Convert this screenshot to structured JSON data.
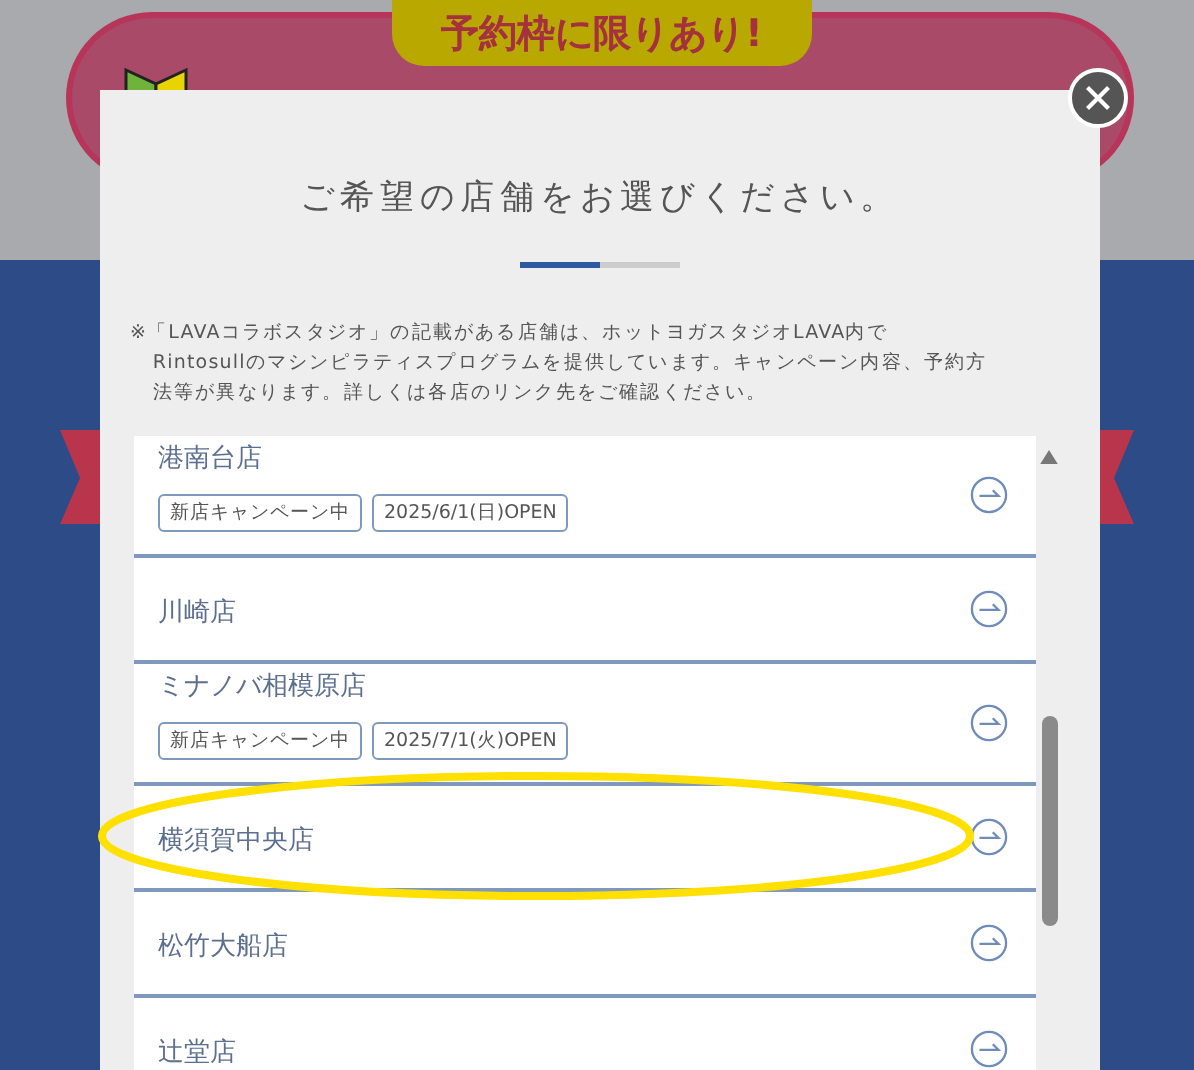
{
  "banner": {
    "tag": "予約枠に限りあり!"
  },
  "modal": {
    "title": "ご希望の店舗をお選びください。",
    "steps": [
      {
        "selected": true
      },
      {
        "selected": false
      }
    ],
    "note_lines": [
      "※「LAVAコラボスタジオ」の記載がある店舗は、ホットヨガスタジオLAVA内で",
      "Rintosullのマシンピラティスプログラムを提供しています。キャンペーン内容、予約方",
      "法等が異なります。詳しくは各店のリンク先をご確認ください。"
    ],
    "stores": [
      {
        "name": "港南台店",
        "tags": [
          "新店キャンペーン中",
          "2025/6/1(日)OPEN"
        ],
        "highlighted": false
      },
      {
        "name": "川崎店",
        "highlighted": false
      },
      {
        "name": "ミナノバ相模原店",
        "tags": [
          "新店キャンペーン中",
          "2025/7/1(火)OPEN"
        ],
        "highlighted": false
      },
      {
        "name": "横須賀中央店",
        "highlighted": true
      },
      {
        "name": "松竹大船店",
        "highlighted": false
      },
      {
        "name": "辻堂店",
        "highlighted": false
      }
    ]
  }
}
